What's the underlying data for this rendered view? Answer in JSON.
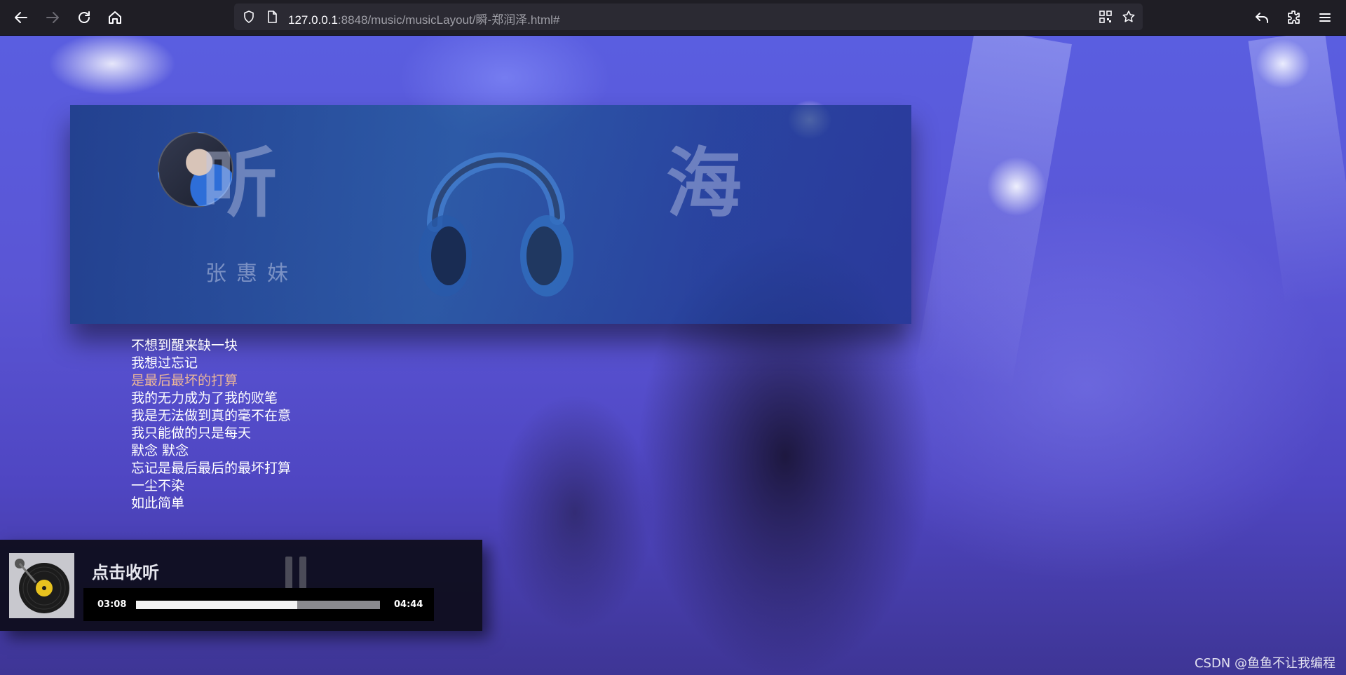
{
  "browser": {
    "url_host": "127.0.0.1",
    "url_rest": ":8848/music/musicLayout/瞬-郑润泽.html#"
  },
  "banner": {
    "char_left": "听",
    "char_right": "海",
    "artist": "张惠妹"
  },
  "lyrics": [
    {
      "text": "不想到醒来缺一块",
      "active": false
    },
    {
      "text": "我想过忘记",
      "active": false
    },
    {
      "text": "是最后最坏的打算",
      "active": true
    },
    {
      "text": "我的无力成为了我的败笔",
      "active": false
    },
    {
      "text": "我是无法做到真的毫不在意",
      "active": false
    },
    {
      "text": "我只能做的只是每天",
      "active": false
    },
    {
      "text": "默念 默念",
      "active": false
    },
    {
      "text": "忘记是最后最后的最坏打算",
      "active": false
    },
    {
      "text": "一尘不染",
      "active": false
    },
    {
      "text": "如此简单",
      "active": false
    }
  ],
  "player": {
    "title": "点击收听",
    "current_time": "03:08",
    "total_time": "04:44",
    "progress": 0.66
  },
  "watermark": "CSDN @鱼鱼不让我编程",
  "colors": {
    "active_lyric": "#e9b59a",
    "toolbar_bg": "#1f1e25"
  }
}
